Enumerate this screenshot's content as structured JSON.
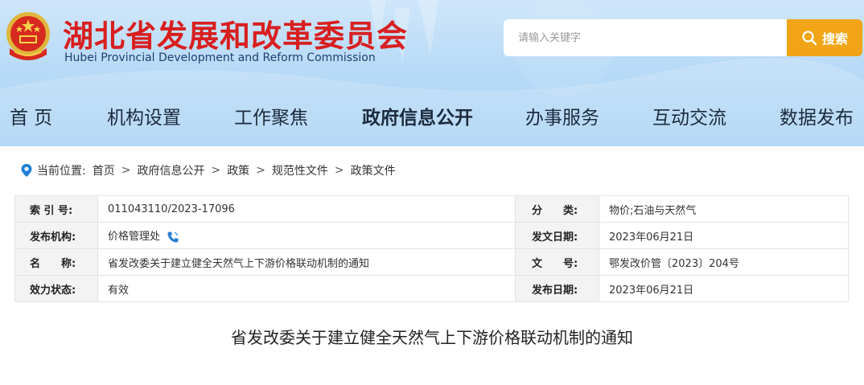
{
  "header": {
    "title_cn": "湖北省发展和改革委员会",
    "title_en": "Hubei Provincial Development and Reform Commission",
    "search": {
      "placeholder": "请输入关键字",
      "button_label": "搜索"
    }
  },
  "nav": {
    "items": [
      {
        "label": "首 页"
      },
      {
        "label": "机构设置"
      },
      {
        "label": "工作聚焦"
      },
      {
        "label": "政府信息公开",
        "active": true
      },
      {
        "label": "办事服务"
      },
      {
        "label": "互动交流"
      },
      {
        "label": "数据发布"
      }
    ]
  },
  "breadcrumb": {
    "prefix": "当前位置:",
    "items": [
      "首页",
      "政府信息公开",
      "政策",
      "规范性文件",
      "政策文件"
    ],
    "separator": ">"
  },
  "info": {
    "rows": [
      {
        "label1": "索 引 号:",
        "value1": "011043110/2023-17096",
        "label2": "分　　类:",
        "value2": "物价;石油与天然气"
      },
      {
        "label1": "发布机构:",
        "value1": "价格管理处",
        "label2": "发文日期:",
        "value2": "2023年06月21日"
      },
      {
        "label1": "名　　称:",
        "value1": "省发改委关于建立健全天然气上下游价格联动机制的通知",
        "label2": "文　　号:",
        "value2": "鄂发改价管〔2023〕204号"
      },
      {
        "label1": "效力状态:",
        "value1": "有效",
        "label2": "发布日期:",
        "value2": "2023年06月21日"
      }
    ]
  },
  "article": {
    "title": "省发改委关于建立健全天然气上下游价格联动机制的通知"
  },
  "colors": {
    "title_red": "#d81f1f",
    "search_orange": "#f1a516",
    "header_blue": "#b9dbf7",
    "pin_blue": "#1e7fd6"
  }
}
